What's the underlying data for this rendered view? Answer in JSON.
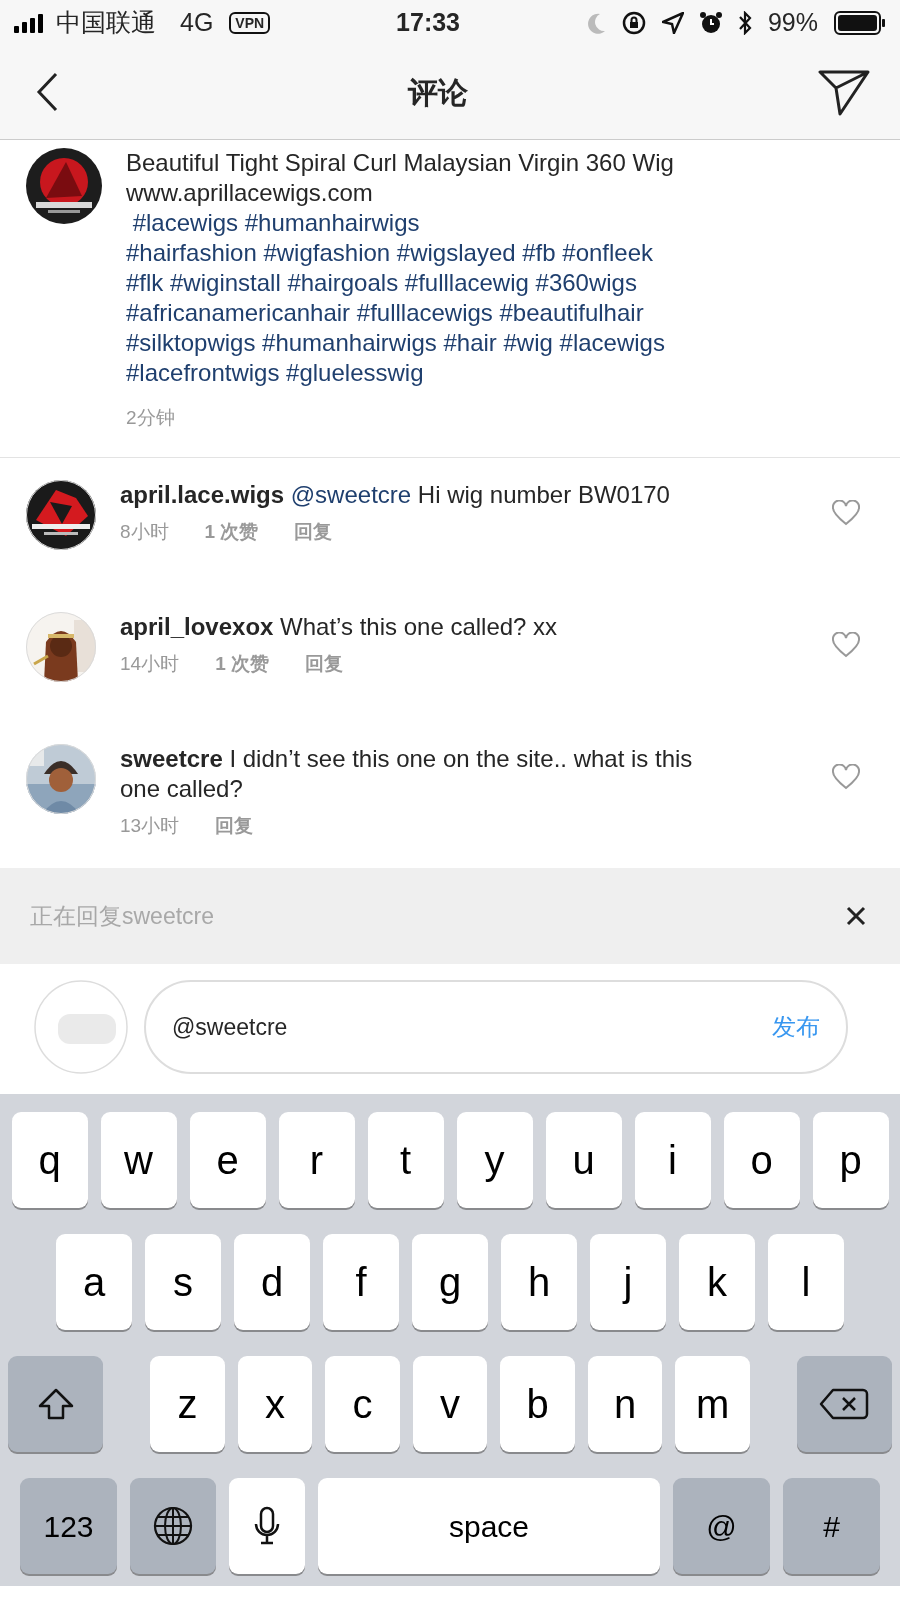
{
  "status_bar": {
    "carrier": "中国联通",
    "network": "4G",
    "vpn": "VPN",
    "time": "17:33",
    "battery": "99%"
  },
  "nav": {
    "title": "评论"
  },
  "caption": {
    "lines": [
      {
        "kind": "plain",
        "text": "Beautiful Tight Spiral Curl Malaysian Virgin 360 Wig"
      },
      {
        "kind": "plain",
        "text": "www.aprillacewigs.com"
      },
      {
        "kind": "hashtags",
        "text": " #lacewigs #humanhairwigs"
      },
      {
        "kind": "hashtags",
        "text": "#hairfashion #wigfashion #wigslayed #fb #onfleek"
      },
      {
        "kind": "hashtags",
        "text": "#flk #wiginstall #hairgoals #fulllacewig #360wigs"
      },
      {
        "kind": "hashtags",
        "text": "#africanamericanhair #fulllacewigs #beautifulhair"
      },
      {
        "kind": "hashtags",
        "text": "#silktopwigs #humanhairwigs #hair #wig #lacewigs"
      },
      {
        "kind": "hashtags",
        "text": "#lacefrontwigs #gluelesswig"
      }
    ],
    "time": "2分钟"
  },
  "comments": [
    {
      "username": "april.lace.wigs",
      "mention": "@sweetcre",
      "text": " Hi wig number BW0170",
      "time": "8小时",
      "likes": "1 次赞",
      "reply": "回复",
      "liked": false
    },
    {
      "username": "april_lovexox",
      "text": " What’s this one called? xx",
      "time": "14小时",
      "likes": "1 次赞",
      "reply": "回复",
      "liked": false
    },
    {
      "username": "sweetcre",
      "text": " I didn’t see this one on the site.. what is this one called?",
      "time": "13小时",
      "reply": "回复",
      "liked": false
    }
  ],
  "reply_bar": {
    "text": "正在回复sweetcre"
  },
  "composer": {
    "value": "@sweetcre",
    "post": "发布"
  },
  "keyboard": {
    "rows": [
      {
        "keys": [
          {
            "kind": "letter",
            "label": "q"
          },
          {
            "kind": "letter",
            "label": "w"
          },
          {
            "kind": "letter",
            "label": "e"
          },
          {
            "kind": "letter",
            "label": "r"
          },
          {
            "kind": "letter",
            "label": "t"
          },
          {
            "kind": "letter",
            "label": "y"
          },
          {
            "kind": "letter",
            "label": "u"
          },
          {
            "kind": "letter",
            "label": "i"
          },
          {
            "kind": "letter",
            "label": "o"
          },
          {
            "kind": "letter",
            "label": "p"
          }
        ]
      },
      {
        "keys": [
          {
            "kind": "letter",
            "label": "a"
          },
          {
            "kind": "letter",
            "label": "s"
          },
          {
            "kind": "letter",
            "label": "d"
          },
          {
            "kind": "letter",
            "label": "f"
          },
          {
            "kind": "letter",
            "label": "g"
          },
          {
            "kind": "letter",
            "label": "h"
          },
          {
            "kind": "letter",
            "label": "j"
          },
          {
            "kind": "letter",
            "label": "k"
          },
          {
            "kind": "letter",
            "label": "l"
          }
        ]
      },
      {
        "keys": [
          {
            "kind": "shift"
          },
          {
            "kind": "letter",
            "label": "z"
          },
          {
            "kind": "letter",
            "label": "x"
          },
          {
            "kind": "letter",
            "label": "c"
          },
          {
            "kind": "letter",
            "label": "v"
          },
          {
            "kind": "letter",
            "label": "b"
          },
          {
            "kind": "letter",
            "label": "n"
          },
          {
            "kind": "letter",
            "label": "m"
          },
          {
            "kind": "delete"
          }
        ]
      },
      {
        "keys": [
          {
            "kind": "function",
            "label": "123"
          },
          {
            "kind": "globe"
          },
          {
            "kind": "mic"
          },
          {
            "kind": "space",
            "label": "space"
          },
          {
            "kind": "function",
            "label": "@"
          },
          {
            "kind": "function",
            "label": "#"
          }
        ]
      }
    ]
  }
}
